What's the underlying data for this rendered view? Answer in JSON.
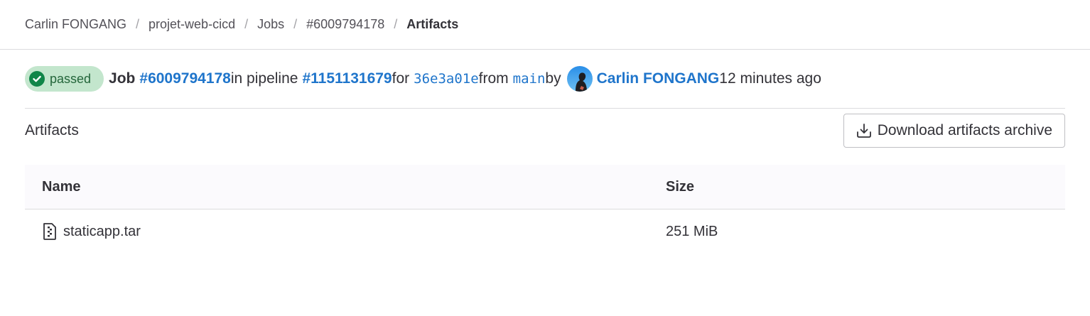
{
  "breadcrumb": {
    "items": [
      "Carlin FONGANG",
      "projet-web-cicd",
      "Jobs",
      "#6009794178"
    ],
    "current": "Artifacts",
    "separator": "/"
  },
  "job": {
    "status": "passed",
    "job_label": "Job",
    "job_id": "#6009794178",
    "in_pipeline": "in pipeline",
    "pipeline_id": "#1151131679",
    "for": "for",
    "commit": "36e3a01e",
    "from": "from",
    "branch": "main",
    "by": "by",
    "user": "Carlin FONGANG",
    "time": "12 minutes ago"
  },
  "artifacts": {
    "title": "Artifacts",
    "download_label": "Download artifacts archive",
    "columns": {
      "name": "Name",
      "size": "Size"
    },
    "rows": [
      {
        "name": "staticapp.tar",
        "size": "251 MiB"
      }
    ]
  },
  "colors": {
    "link": "#1f75cb",
    "status_bg": "#c3e6cd",
    "status_icon": "#108548"
  }
}
